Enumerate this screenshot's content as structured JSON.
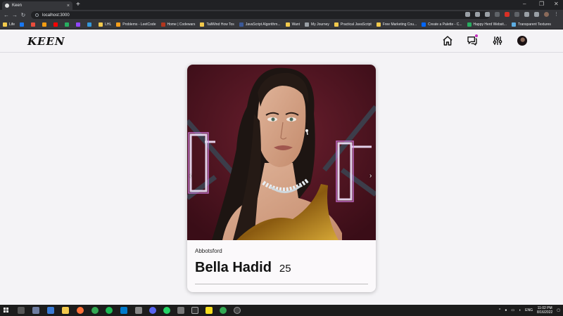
{
  "browser": {
    "tab_title": "Keen",
    "tab_close": "×",
    "new_tab": "+",
    "window_controls": [
      "–",
      "❐",
      "✕"
    ],
    "nav": [
      "←",
      "→",
      "↻"
    ],
    "url": "localhost:3000",
    "bookmarks": [
      {
        "label": "Life",
        "icon": "folder-icon",
        "color": "#f2c94c"
      },
      {
        "label": "",
        "icon": "facebook-icon",
        "color": "#1877f2"
      },
      {
        "label": "",
        "icon": "app-icon",
        "color": "#e74c3c"
      },
      {
        "label": "",
        "icon": "app-icon",
        "color": "#f39c12"
      },
      {
        "label": "",
        "icon": "youtube-icon",
        "color": "#ff0000"
      },
      {
        "label": "",
        "icon": "app-icon",
        "color": "#27ae60"
      },
      {
        "label": "",
        "icon": "twitch-icon",
        "color": "#9146ff"
      },
      {
        "label": "",
        "icon": "app-icon",
        "color": "#3498db"
      },
      {
        "label": "LHL",
        "icon": "folder-icon",
        "color": "#f2c94c"
      },
      {
        "label": "Problems - LeetCode",
        "icon": "leetcode-icon",
        "color": "#f89f1b"
      },
      {
        "label": "Home | Codewars",
        "icon": "codewars-icon",
        "color": "#b1361e"
      },
      {
        "label": "TailWind How Tos",
        "icon": "folder-icon",
        "color": "#f2c94c"
      },
      {
        "label": "JavaScript Algorithm...",
        "icon": "app-icon",
        "color": "#3b5998"
      },
      {
        "label": "Want",
        "icon": "folder-icon",
        "color": "#f2c94c"
      },
      {
        "label": "My Journey",
        "icon": "globe-icon",
        "color": "#9aa0a6"
      },
      {
        "label": "Practical JavaScript",
        "icon": "folder-icon",
        "color": "#f2c94c"
      },
      {
        "label": "Free Marketing Cou...",
        "icon": "folder-icon",
        "color": "#f2c94c"
      },
      {
        "label": "Create a Palette - C...",
        "icon": "coolors-icon",
        "color": "#0066ff"
      },
      {
        "label": "Happy Herd Websit...",
        "icon": "app-icon",
        "color": "#27ae60"
      },
      {
        "label": "Transparent Textures",
        "icon": "app-icon",
        "color": "#5dade2"
      }
    ]
  },
  "app": {
    "logo": "KEEN",
    "nav_icons": [
      "home-icon",
      "chat-icon",
      "filters-icon",
      "avatar"
    ]
  },
  "card": {
    "location": "Abbotsford",
    "name": "Bella Hadid",
    "age": "25",
    "prev_arrow": "‹",
    "next_arrow": "›"
  },
  "taskbar": {
    "language": "ENG",
    "time": "11:02 PM",
    "date": "8/16/2022"
  },
  "colors": {
    "page_bg": "#f4f3f6",
    "card_bg": "#fbf9fb",
    "notification": "#c22ebd"
  }
}
